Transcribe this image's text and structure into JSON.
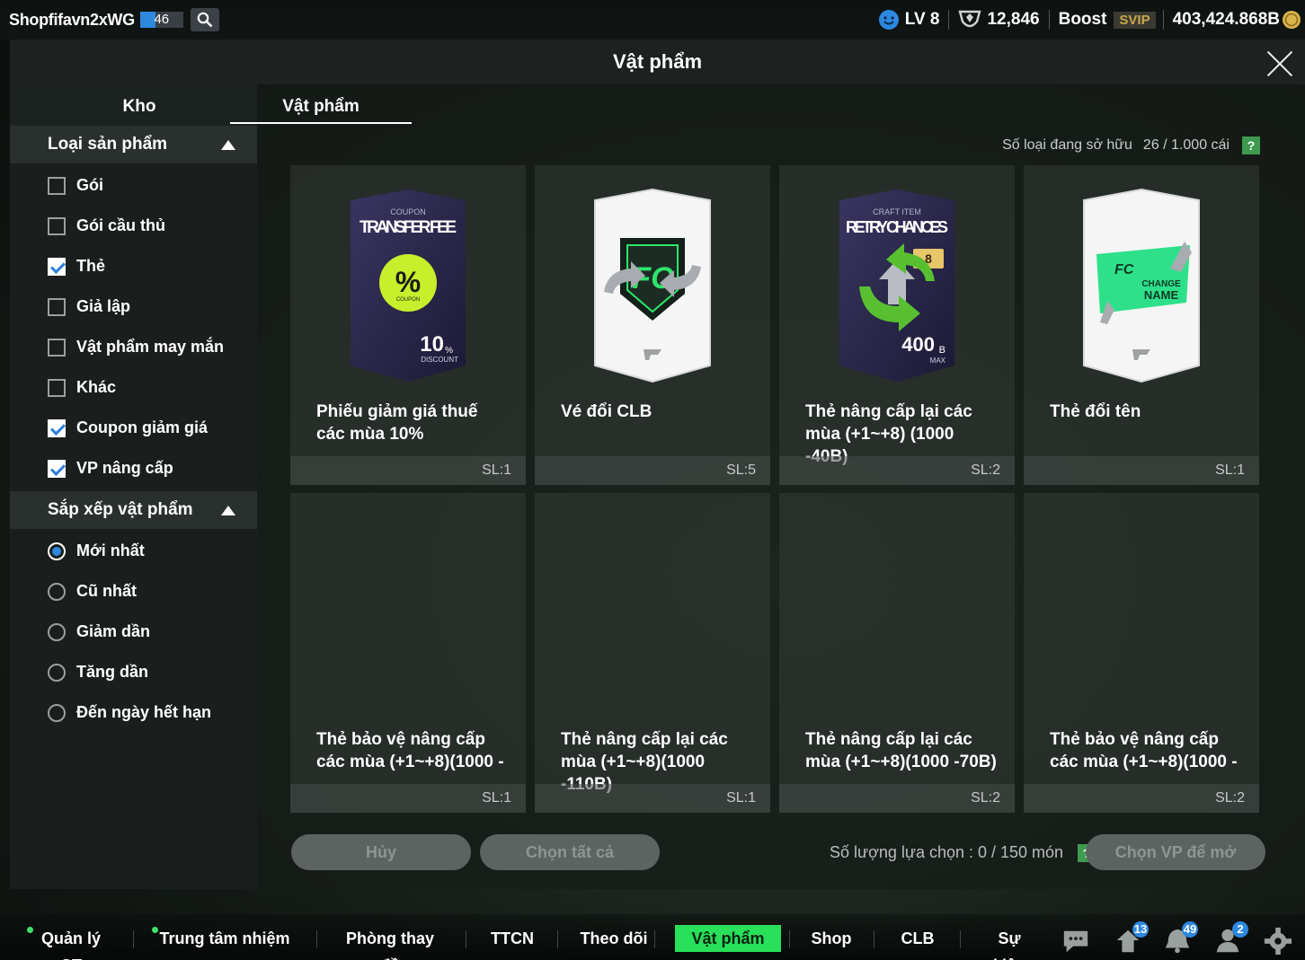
{
  "topbar": {
    "username": "Shopfifavn2xWG",
    "level_badge": "46",
    "level_progress": 0.35,
    "lv": "LV 8",
    "points": "12,846",
    "boost": "Boost",
    "svip": "SVIP",
    "coins": "403,424.868B"
  },
  "modal": {
    "title": "Vật phẩm",
    "tabs": [
      {
        "label": "Kho"
      },
      {
        "label": "Vật phẩm"
      }
    ],
    "owned_label": "Số loại đang sở hữu",
    "owned_value": "26 / 1.000 cái"
  },
  "sidebar": {
    "category_title": "Loại sản phẩm",
    "categories": [
      {
        "label": "Gói",
        "checked": false
      },
      {
        "label": "Gói cầu thủ",
        "checked": false
      },
      {
        "label": "Thẻ",
        "checked": true
      },
      {
        "label": "Giả lập",
        "checked": false
      },
      {
        "label": "Vật phẩm may mắn",
        "checked": false
      },
      {
        "label": "Khác",
        "checked": false
      },
      {
        "label": "Coupon giảm giá",
        "checked": true
      },
      {
        "label": "VP nâng cấp",
        "checked": true
      }
    ],
    "sort_title": "Sắp xếp vật phẩm",
    "sorts": [
      {
        "label": "Mới nhất",
        "selected": true
      },
      {
        "label": "Cũ nhất",
        "selected": false
      },
      {
        "label": "Giảm dần",
        "selected": false
      },
      {
        "label": "Tăng dần",
        "selected": false
      },
      {
        "label": "Đến ngày hết hạn",
        "selected": false
      }
    ]
  },
  "items": [
    {
      "name": "Phiếu giảm giá thuế các mùa 10%",
      "qty": "SL:1",
      "art": {
        "kind": "coupon",
        "top": "COUPON",
        "title": "TRANSFER FEE",
        "big": "10",
        "unit": "%",
        "sub": "DISCOUNT",
        "badge": "COUPON"
      }
    },
    {
      "name": "Vé đổi CLB",
      "qty": "SL:5",
      "art": {
        "kind": "club"
      }
    },
    {
      "name": "Thẻ nâng cấp lại các mùa (+1~+8) (1000 -40B)",
      "qty": "SL:2",
      "art": {
        "kind": "retry",
        "top": "CRAFT ITEM",
        "title": "RETRY CHANCES",
        "big": "400",
        "unit": "B",
        "sub": "MAX",
        "badge": "8"
      }
    },
    {
      "name": "Thẻ đổi tên",
      "qty": "SL:1",
      "art": {
        "kind": "rename",
        "line1": "CHANGE",
        "line2": "NAME"
      }
    },
    {
      "name": "Thẻ bảo vệ nâng cấp các mùa (+1~+8)(1000 -",
      "qty": "SL:1",
      "art": {
        "kind": "none"
      }
    },
    {
      "name": "Thẻ nâng cấp lại các mùa (+1~+8)(1000 -110B)",
      "qty": "SL:1",
      "art": {
        "kind": "none"
      }
    },
    {
      "name": "Thẻ nâng cấp lại các mùa (+1~+8)(1000 -70B)",
      "qty": "SL:2",
      "art": {
        "kind": "none"
      }
    },
    {
      "name": "Thẻ bảo vệ nâng cấp các mùa (+1~+8)(1000 -",
      "qty": "SL:2",
      "art": {
        "kind": "none"
      }
    }
  ],
  "actions": {
    "cancel": "Hủy",
    "select_all": "Chọn tất cả",
    "selection_label": "Số lượng lựa chọn : 0 / 150 món",
    "open": "Chọn VP để mở"
  },
  "bottomnav": {
    "items": [
      {
        "label": "Quản lý CT",
        "dot": true,
        "active": false
      },
      {
        "label": "Trung tâm nhiệm vụ",
        "dot": true,
        "active": false
      },
      {
        "label": "Phòng thay đồ",
        "dot": false,
        "active": false
      },
      {
        "label": "TTCN",
        "dot": false,
        "active": false
      },
      {
        "label": "Theo dõi",
        "dot": false,
        "active": false
      },
      {
        "label": "Vật phẩm",
        "dot": false,
        "active": true
      },
      {
        "label": "Shop",
        "dot": false,
        "active": false
      },
      {
        "label": "CLB",
        "dot": false,
        "active": false
      },
      {
        "label": "Sự kiện",
        "dot": false,
        "active": false
      }
    ],
    "icons": [
      {
        "name": "chat-icon",
        "badge": ""
      },
      {
        "name": "upload-icon",
        "badge": "13"
      },
      {
        "name": "bell-icon",
        "badge": "49"
      },
      {
        "name": "friends-icon",
        "badge": "2"
      },
      {
        "name": "settings-gear-icon",
        "badge": ""
      }
    ]
  },
  "colors": {
    "accent_green": "#28e05a",
    "accent_blue": "#2d88e0",
    "help_green": "#3e9a4e"
  }
}
